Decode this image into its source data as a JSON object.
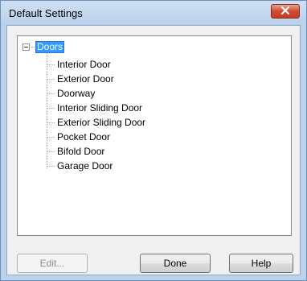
{
  "window": {
    "title": "Default Settings",
    "close_icon": "close-x-icon"
  },
  "tree": {
    "root": {
      "label": "Doors",
      "expanded": true,
      "selected": true
    },
    "children": [
      {
        "label": "Interior Door"
      },
      {
        "label": "Exterior Door"
      },
      {
        "label": "Doorway"
      },
      {
        "label": "Interior Sliding Door"
      },
      {
        "label": "Exterior Sliding Door"
      },
      {
        "label": "Pocket Door"
      },
      {
        "label": "Bifold Door"
      },
      {
        "label": "Garage Door"
      }
    ]
  },
  "buttons": {
    "edit": {
      "label": "Edit...",
      "enabled": false
    },
    "done": {
      "label": "Done",
      "enabled": true
    },
    "help": {
      "label": "Help",
      "enabled": true
    }
  },
  "colors": {
    "selection": "#3399ff",
    "close_button": "#c9452a",
    "title_bar": "#bcd2ea"
  }
}
